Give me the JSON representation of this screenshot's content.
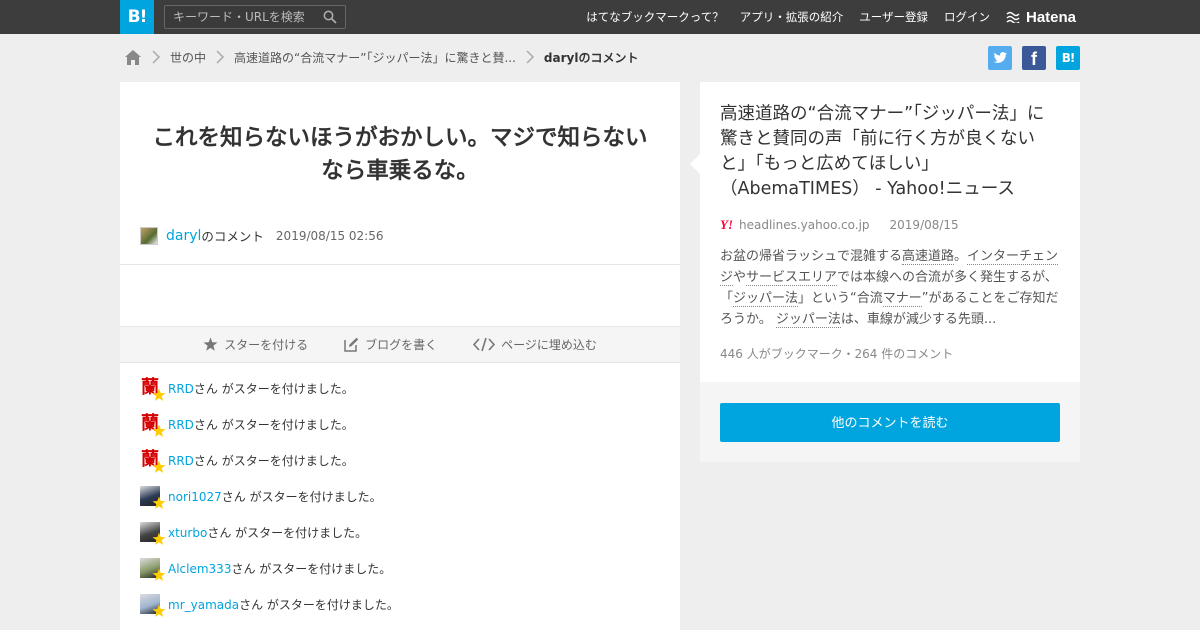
{
  "topbar": {
    "logo": "B!",
    "search_placeholder": "キーワード・URLを検索",
    "nav": [
      "はてなブックマークって？",
      "アプリ・拡張の紹介",
      "ユーザー登録",
      "ログイン"
    ],
    "brand": "Hatena"
  },
  "breadcrumb": {
    "items": [
      "世の中",
      "高速道路の“合流マナー”「ジッパー法」に驚きと賛...",
      "darylのコメント"
    ]
  },
  "share": {
    "facebook": "f",
    "hatena": "B!"
  },
  "comment": {
    "text": "これを知らないほうがおかしい。マジで知らないなら車乗るな。",
    "user": "daryl",
    "user_suffix": "のコメント",
    "date": "2019/08/15 02:56"
  },
  "actions": {
    "star": "スターを付ける",
    "blog": "ブログを書く",
    "embed": "ページに埋め込む"
  },
  "stars": [
    {
      "user": "RRD",
      "suffix": "さん がスターを付けました。",
      "avatar": "kanji",
      "avatar_text": "蘭"
    },
    {
      "user": "RRD",
      "suffix": "さん がスターを付けました。",
      "avatar": "kanji",
      "avatar_text": "蘭"
    },
    {
      "user": "RRD",
      "suffix": "さん がスターを付けました。",
      "avatar": "kanji",
      "avatar_text": "蘭"
    },
    {
      "user": "nori1027",
      "suffix": "さん がスターを付けました。",
      "avatar": "photo",
      "color": "#2b3a55"
    },
    {
      "user": "xturbo",
      "suffix": "さん がスターを付けました。",
      "avatar": "photo",
      "color": "#444444"
    },
    {
      "user": "Alclem333",
      "suffix": "さん がスターを付けました。",
      "avatar": "photo",
      "color": "#8a9a6a"
    },
    {
      "user": "mr_yamada",
      "suffix": "さん がスターを付けました。",
      "avatar": "photo",
      "color": "#9fb4d0"
    }
  ],
  "entry": {
    "title": "高速道路の“合流マナー”「ジッパー法」に驚きと賛同の声「前に行く方が良くないと」「もっと広めてほしい」（AbemaTIMES） - Yahoo!ニュース",
    "source_logo": "Y!",
    "domain": "headlines.yahoo.co.jp",
    "date": "2019/08/15",
    "description_parts": [
      {
        "t": "お盆の帰省ラッシュで混雑する",
        "u": false
      },
      {
        "t": "高速道路",
        "u": true
      },
      {
        "t": "。",
        "u": false
      },
      {
        "t": "インターチェンジ",
        "u": true
      },
      {
        "t": "や",
        "u": false
      },
      {
        "t": "サービスエリア",
        "u": true
      },
      {
        "t": "では本線への合流が多く発生するが、「",
        "u": false
      },
      {
        "t": "ジッパー法",
        "u": true
      },
      {
        "t": "」という“合流",
        "u": false
      },
      {
        "t": "マナー",
        "u": true
      },
      {
        "t": "”があることをご存知だろうか。 ",
        "u": false
      },
      {
        "t": "ジッパー法",
        "u": true
      },
      {
        "t": "は、車線が減少する先頭...",
        "u": false
      }
    ],
    "counts": "446 人がブックマーク・264 件のコメント",
    "read_button": "他のコメントを読む"
  },
  "colors": {
    "accent": "#00a4de",
    "topbar": "#3d3d3d",
    "star": "#ffcc00"
  }
}
